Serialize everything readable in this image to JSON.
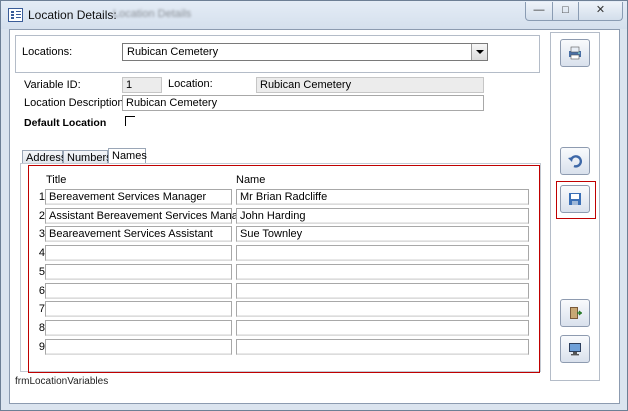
{
  "window": {
    "title": "Location Details:",
    "title_suffix": "Location Details",
    "min_symbol": "—",
    "max_symbol": "□",
    "close_symbol": "✕"
  },
  "location": {
    "label": "Locations:",
    "selected": "Rubican Cemetery"
  },
  "details": {
    "variable_id_label": "Variable ID:",
    "variable_id": "1",
    "location_label": "Location:",
    "location_value": "Rubican Cemetery",
    "description_label": "Location Description:",
    "description_value": "Rubican Cemetery",
    "default_label": "Default Location"
  },
  "tabs": [
    {
      "label": "Address"
    },
    {
      "label": "Numbers"
    },
    {
      "label": "Names",
      "active": true
    }
  ],
  "grid": {
    "title_header": "Title",
    "name_header": "Name",
    "rows": [
      {
        "num": "1",
        "title": "Bereavement Services Manager",
        "name": "Mr Brian Radcliffe"
      },
      {
        "num": "2",
        "title": "Assistant Bereavement Services Manager",
        "name": "John Harding"
      },
      {
        "num": "3",
        "title": "Beareavement Services Assistant",
        "name": "Sue Townley"
      },
      {
        "num": "4",
        "title": "",
        "name": ""
      },
      {
        "num": "5",
        "title": "",
        "name": ""
      },
      {
        "num": "6",
        "title": "",
        "name": ""
      },
      {
        "num": "7",
        "title": "",
        "name": ""
      },
      {
        "num": "8",
        "title": "",
        "name": ""
      },
      {
        "num": "9",
        "title": "",
        "name": ""
      }
    ]
  },
  "footer": {
    "form_name": "frmLocationVariables"
  },
  "sidebar": {
    "icons": [
      "print-icon",
      "undo-icon",
      "save-icon",
      "exit-door-icon",
      "monitor-icon"
    ]
  },
  "colors": {
    "highlight": "#c00000",
    "window_frame": "#dbe4ef"
  }
}
